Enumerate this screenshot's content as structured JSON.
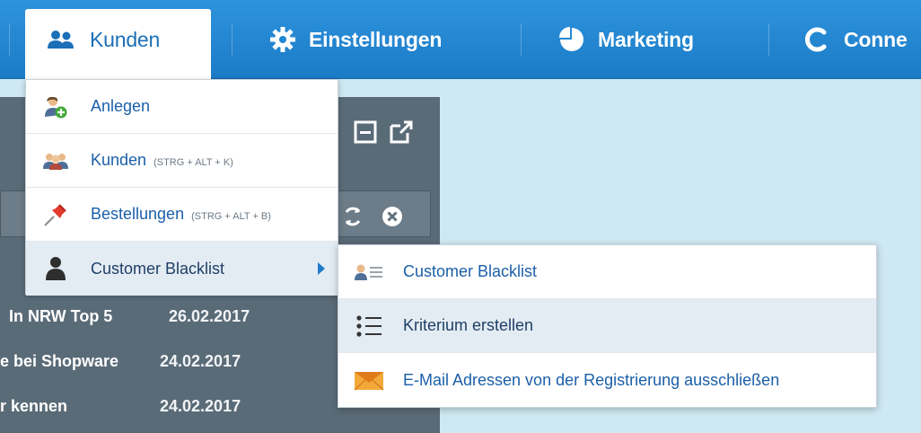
{
  "nav": {
    "items": [
      {
        "label": "Kunden",
        "icon": "users-icon"
      },
      {
        "label": "Einstellungen",
        "icon": "gear-icon"
      },
      {
        "label": "Marketing",
        "icon": "pie-chart-icon"
      },
      {
        "label": "Conne",
        "icon": "connect-icon"
      }
    ]
  },
  "menu": {
    "items": [
      {
        "label": "Anlegen",
        "shortcut": "",
        "icon": "add-user-icon"
      },
      {
        "label": "Kunden",
        "shortcut": "(STRG + ALT + K)",
        "icon": "customers-icon"
      },
      {
        "label": "Bestellungen",
        "shortcut": "(STRG + ALT + B)",
        "icon": "pin-icon"
      },
      {
        "label": "Customer Blacklist",
        "shortcut": "",
        "icon": "person-icon"
      }
    ]
  },
  "submenu": {
    "items": [
      {
        "label": "Customer Blacklist",
        "icon": "user-list-icon"
      },
      {
        "label": "Kriterium erstellen",
        "icon": "list-icon"
      },
      {
        "label": "E-Mail Adressen von der Registrierung ausschließen",
        "icon": "envelope-icon"
      }
    ]
  },
  "background": {
    "rows": [
      {
        "title": "In NRW Top 5",
        "date": "26.02.2017"
      },
      {
        "title": "e bei Shopware",
        "date": "24.02.2017"
      },
      {
        "title": "r kennen",
        "date": "24.02.2017"
      }
    ]
  },
  "colors": {
    "nav_blue": "#1b7bc6",
    "link_blue": "#1b5fa8",
    "hover_bg": "#e4ecf3"
  }
}
